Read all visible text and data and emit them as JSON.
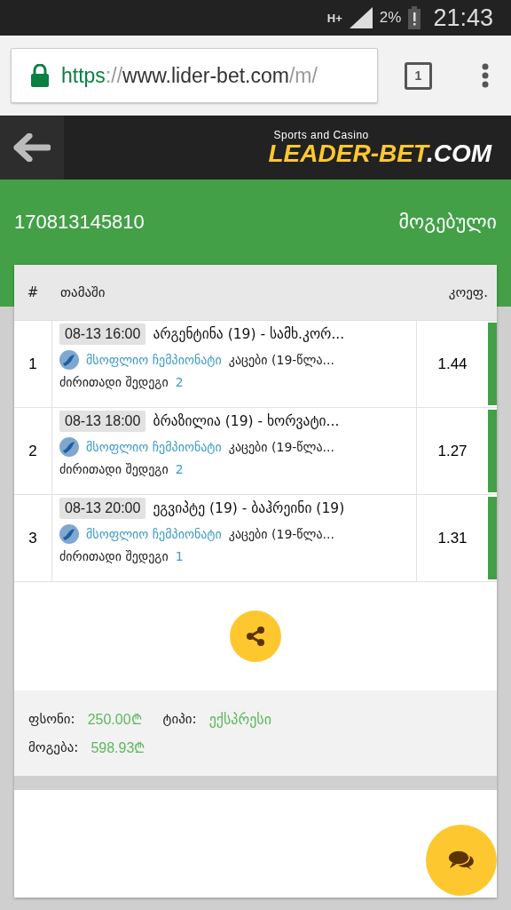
{
  "status_bar": {
    "network": "H+",
    "battery": "2%",
    "time": "21:43"
  },
  "browser": {
    "url_scheme": "https",
    "url_sep": "://",
    "url_host": "www.lider-bet.com",
    "url_path": "/m/",
    "tab_count": "1"
  },
  "logo": {
    "tagline": "Sports and Casino",
    "name": "LEADER-BET",
    "suffix": ".COM"
  },
  "ticket": {
    "id": "170813145810",
    "status": "მოგებული"
  },
  "table": {
    "columns": [
      "#",
      "თამაში",
      "კოეფ."
    ],
    "rows": [
      {
        "index": "1",
        "time": "08-13 16:00",
        "match": "არგენტინა (19) - სამხ.კორ...",
        "tournament": "მსოფლიო ჩემპიონატი",
        "category": "კაცები (19-წლა...",
        "market": "ძირითადი შედეგი",
        "pick": "2",
        "odds": "1.44",
        "color": "#43a047"
      },
      {
        "index": "2",
        "time": "08-13 18:00",
        "match": "ბრაზილია (19) - ხორვატი...",
        "tournament": "მსოფლიო ჩემპიონატი",
        "category": "კაცები (19-წლა...",
        "market": "ძირითადი შედეგი",
        "pick": "2",
        "odds": "1.27",
        "color": "#43a047"
      },
      {
        "index": "3",
        "time": "08-13 20:00",
        "match": "ეგვიპტე (19) - ბაჰრეინი (19)",
        "tournament": "მსოფლიო ჩემპიონატი",
        "category": "კაცები (19-წლა...",
        "market": "ძირითადი შედეგი",
        "pick": "1",
        "odds": "1.31",
        "color": "#43a047"
      }
    ]
  },
  "summary": {
    "stake_label": "ფსონი:",
    "stake": "250.00₾",
    "type_label": "ტიპი:",
    "type": "ექსპრესი",
    "win_label": "მოგება:",
    "win": "598.93₾"
  }
}
